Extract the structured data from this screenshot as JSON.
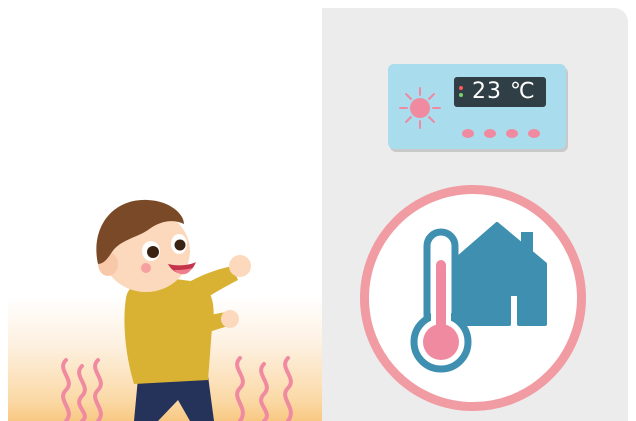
{
  "thermostat": {
    "temperature_text": "23 ℃",
    "icon": "sun-icon",
    "buttons": [
      "button-1",
      "button-2",
      "button-3",
      "button-4"
    ]
  },
  "badge": {
    "icons": [
      "thermometer-icon",
      "house-icon"
    ]
  },
  "illustration": {
    "subject": "child-figure",
    "floor_effect": "heat-waves"
  },
  "colors": {
    "right_background": "#ececec",
    "thermostat_body": "#a9dcec",
    "display": "#2f3f45",
    "accent_pink": "#f19ba2",
    "house_blue": "#3e8fb0",
    "floor_warm": "#f8c882"
  }
}
